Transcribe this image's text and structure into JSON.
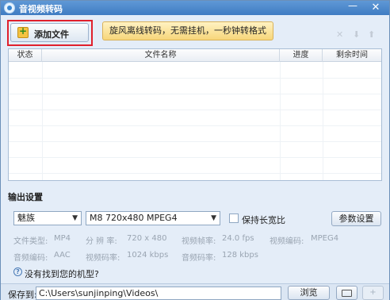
{
  "window": {
    "title": "音视频转码",
    "minimize": "—",
    "close": "✕"
  },
  "toolbar": {
    "add_file_label": "添加文件",
    "promo_label": "旋风离线转码，无需挂机，一秒钟转格式",
    "icons": [
      "delete-icon",
      "move-down-icon",
      "move-up-icon"
    ]
  },
  "table": {
    "columns": [
      "状态",
      "文件名称",
      "进度",
      "剩余时间"
    ],
    "rows": []
  },
  "output": {
    "section_title": "输出设置",
    "device": "魅族",
    "format": "M8 720x480 MPEG4",
    "keep_ratio_label": "保持长宽比",
    "keep_ratio_checked": false,
    "params_button": "参数设置",
    "info": {
      "file_type_label": "文件类型:",
      "file_type_value": "MP4",
      "resolution_label": "分 辨 率:",
      "resolution_value": "720 x 480",
      "video_fps_label": "视频帧率:",
      "video_fps_value": "24.0 fps",
      "video_codec_label": "视频编码:",
      "video_codec_value": "MPEG4",
      "audio_codec_label": "音频编码:",
      "audio_codec_value": "AAC",
      "video_bitrate_label": "视频码率:",
      "video_bitrate_value": "1024 kbps",
      "audio_bitrate_label": "音频码率:",
      "audio_bitrate_value": "128 kbps"
    },
    "help_link": "没有找到您的机型?"
  },
  "bottom": {
    "save_label": "保存到:",
    "save_path": "C:\\Users\\sunjinping\\Videos\\",
    "browse_button": "浏览",
    "export_icon_label": "+"
  }
}
